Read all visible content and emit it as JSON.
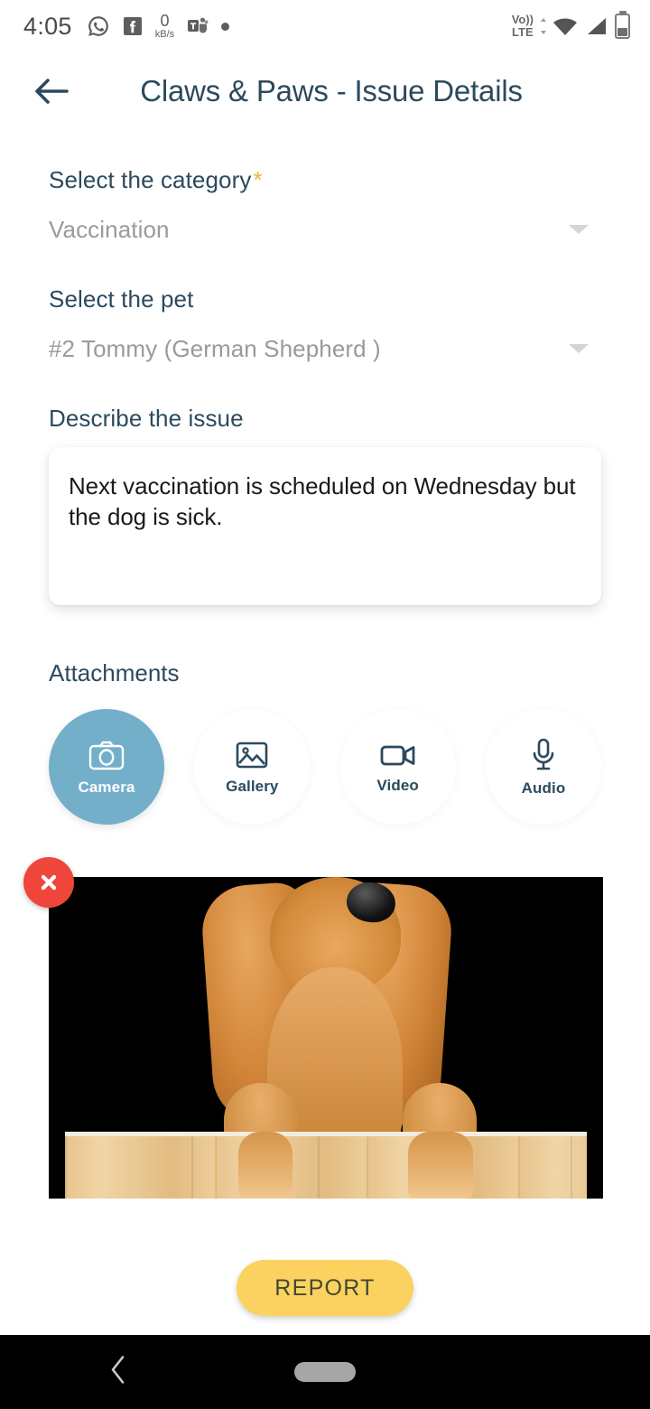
{
  "status_bar": {
    "clock": "4:05",
    "left_icons": [
      {
        "name": "whatsapp-icon",
        "label": "WhatsApp"
      },
      {
        "name": "facebook-icon",
        "label": "Facebook"
      },
      {
        "name": "data-speed-indicator",
        "value": "0",
        "unit": "kB/s"
      },
      {
        "name": "microsoft-teams-icon",
        "label": "Teams"
      },
      {
        "name": "more-notifications-dot",
        "label": "•"
      }
    ],
    "network_label_top": "Vo))",
    "network_label_bottom": "LTE",
    "right_icons": [
      "wifi-icon",
      "cellular-signal-icon",
      "battery-icon"
    ]
  },
  "appbar": {
    "back_label": "Back",
    "title": "Claws & Paws - Issue Details"
  },
  "form": {
    "category": {
      "label": "Select the category",
      "required_marker": "*",
      "value": "Vaccination",
      "placeholder": "Select the category"
    },
    "pet": {
      "label": "Select the pet",
      "value": "#2 Tommy (German Shepherd )",
      "placeholder": "Select the pet"
    },
    "describe": {
      "label": "Describe the issue",
      "value": "Next vaccination is scheduled on Wednesday but the dog is sick.",
      "placeholder": "Describe the issue"
    }
  },
  "attachments": {
    "label": "Attachments",
    "options": [
      {
        "label": "Camera",
        "icon": "camera-icon",
        "selected": true
      },
      {
        "label": "Gallery",
        "icon": "image-icon",
        "selected": false
      },
      {
        "label": "Video",
        "icon": "video-camera-icon",
        "selected": false
      },
      {
        "label": "Audio",
        "icon": "microphone-icon",
        "selected": false
      }
    ],
    "preview": {
      "alt": "Attached photo of a golden cocker spaniel behind a wooden fence",
      "remove_label": "Remove attachment"
    }
  },
  "actions": {
    "report_label": "REPORT"
  },
  "navbar": {
    "back_label": "Back",
    "home_label": "Home"
  },
  "colors": {
    "accent_blue": "#2b4a5e",
    "selected_chip": "#74afc9",
    "required_star": "#e9b73f",
    "report_button": "#fbd25f",
    "remove_button": "#f0453a",
    "placeholder_text": "#9a9a9a"
  }
}
